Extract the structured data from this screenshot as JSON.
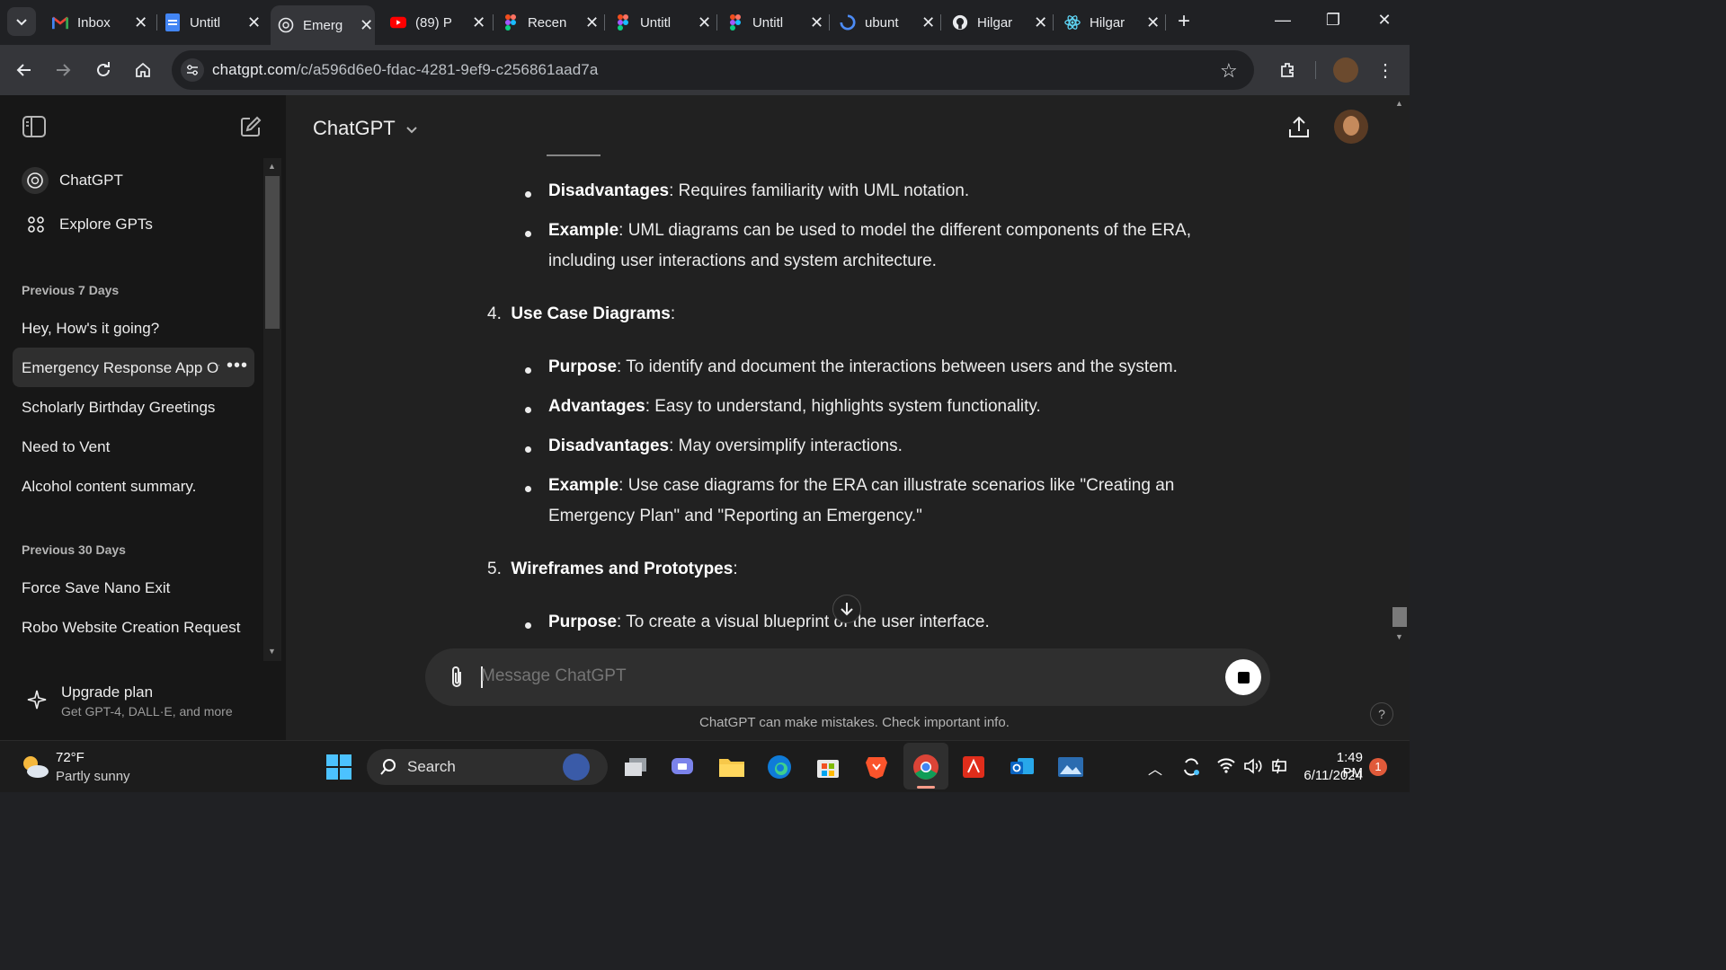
{
  "browser": {
    "tabs": [
      {
        "title": "Inbox",
        "icon": "gmail-icon",
        "active": false
      },
      {
        "title": "Untitl",
        "icon": "docs-icon",
        "active": false
      },
      {
        "title": "Emerg",
        "icon": "chatgpt-icon",
        "active": true
      },
      {
        "title": "(89) P",
        "icon": "youtube-icon",
        "active": false
      },
      {
        "title": "Recen",
        "icon": "figma-icon",
        "active": false
      },
      {
        "title": "Untitl",
        "icon": "figma-icon",
        "active": false
      },
      {
        "title": "Untitl",
        "icon": "figma-icon",
        "active": false
      },
      {
        "title": "ubunt",
        "icon": "loading-icon",
        "active": false
      },
      {
        "title": "Hilgar",
        "icon": "github-icon",
        "active": false
      },
      {
        "title": "Hilgar",
        "icon": "react-icon",
        "active": false
      }
    ],
    "url_domain": "chatgpt.com",
    "url_path": "/c/a596d6e0-fdac-4281-9ef9-c256861aad7a"
  },
  "sidebar": {
    "top_items": [
      {
        "label": "ChatGPT",
        "icon": "chatgpt-logo-icon"
      },
      {
        "label": "Explore GPTs",
        "icon": "grid-icon"
      }
    ],
    "sections": [
      {
        "heading": "Previous 7 Days",
        "items": [
          "Hey, How's it going?",
          "Emergency Response App Ov",
          "Scholarly Birthday Greetings",
          "Need to Vent",
          "Alcohol content summary."
        ]
      },
      {
        "heading": "Previous 30 Days",
        "items": [
          "Force Save Nano Exit",
          "Robo Website Creation Request"
        ]
      }
    ],
    "upgrade": {
      "title": "Upgrade plan",
      "subtitle": "Get GPT-4, DALL·E, and more"
    }
  },
  "main": {
    "title": "ChatGPT",
    "content": {
      "b1_label": "Disadvantages",
      "b1_text": ": Requires familiarity with UML notation.",
      "b2_label": "Example",
      "b2_text": ": UML diagrams can be used to model the different components of the ERA,",
      "b2_text2": "including user interactions and system architecture.",
      "h4_num": "4.",
      "h4_label": "Use Case Diagrams",
      "h4_colon": ":",
      "c1_label": "Purpose",
      "c1_text": ": To identify and document the interactions between users and the system.",
      "c2_label": "Advantages",
      "c2_text": ": Easy to understand, highlights system functionality.",
      "c3_label": "Disadvantages",
      "c3_text": ": May oversimplify interactions.",
      "c4_label": "Example",
      "c4_text": ": Use case diagrams for the ERA can illustrate scenarios like \"Creating an",
      "c4_text2": "Emergency Plan\" and \"Reporting an Emergency.\"",
      "h5_num": "5.",
      "h5_label": "Wireframes and Prototypes",
      "h5_colon": ":",
      "d1_label": "Purpose",
      "d1_text": ": To create a visual blueprint of the user interface."
    },
    "composer_placeholder": "Message ChatGPT",
    "disclaimer": "ChatGPT can make mistakes. Check important info."
  },
  "taskbar": {
    "weather_temp": "72°F",
    "weather_desc": "Partly sunny",
    "search_label": "Search",
    "time": "1:49 PM",
    "date": "6/11/2024",
    "notification_count": "1"
  }
}
